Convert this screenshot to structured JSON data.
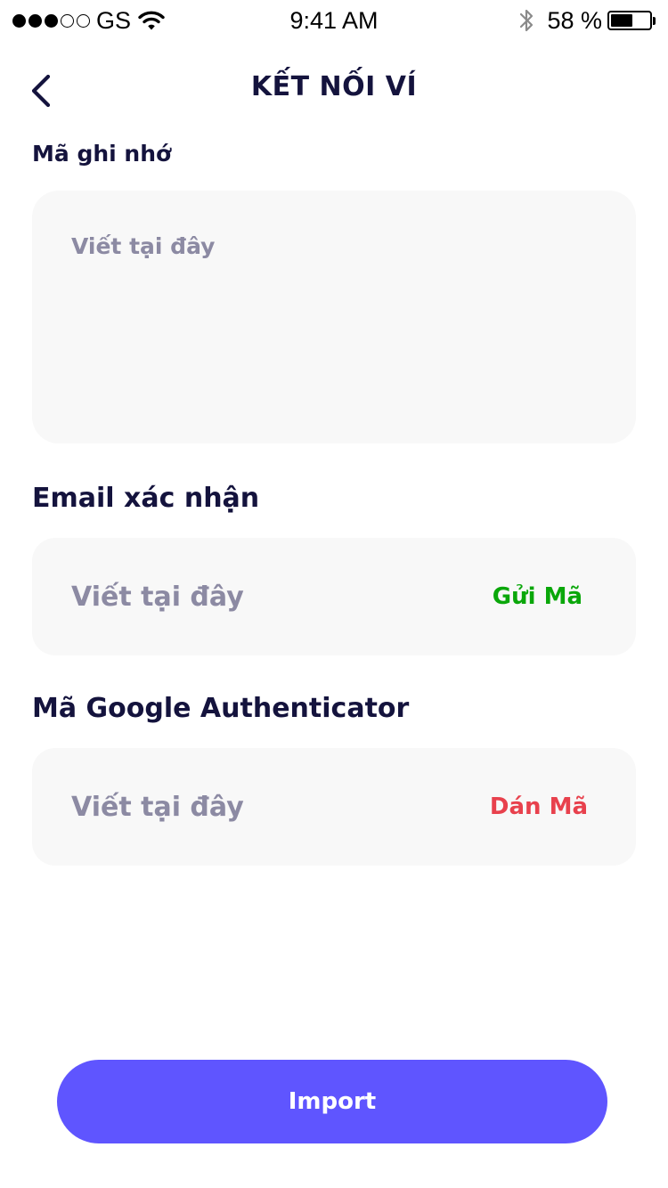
{
  "status_bar": {
    "carrier": "GS",
    "time": "9:41 AM",
    "battery_percent_label": "58 %",
    "battery_level": 0.58,
    "signal_bars_filled": 3,
    "signal_bars_total": 5
  },
  "header": {
    "title": "KẾT NỐI VÍ"
  },
  "mnemonic": {
    "label": "Mã ghi nhớ",
    "placeholder": "Viết tại đây"
  },
  "email": {
    "label": "Email xác nhận",
    "placeholder": "Viết tại đây",
    "action_label": "Gửi Mã"
  },
  "google_auth": {
    "label": "Mã Google Authenticator",
    "placeholder": "Viết tại đây",
    "action_label": "Dán Mã"
  },
  "import_button": {
    "label": "Import"
  },
  "colors": {
    "primary": "#5f55ff",
    "send_code": "#0aa70a",
    "paste_code": "#e8414d",
    "text_dark": "#14133d",
    "placeholder": "#8c8aa3",
    "field_bg": "#f8f8f8"
  },
  "icons": {
    "back": "chevron-left-icon",
    "wifi": "wifi-icon",
    "bluetooth": "bluetooth-icon",
    "battery": "battery-icon"
  }
}
